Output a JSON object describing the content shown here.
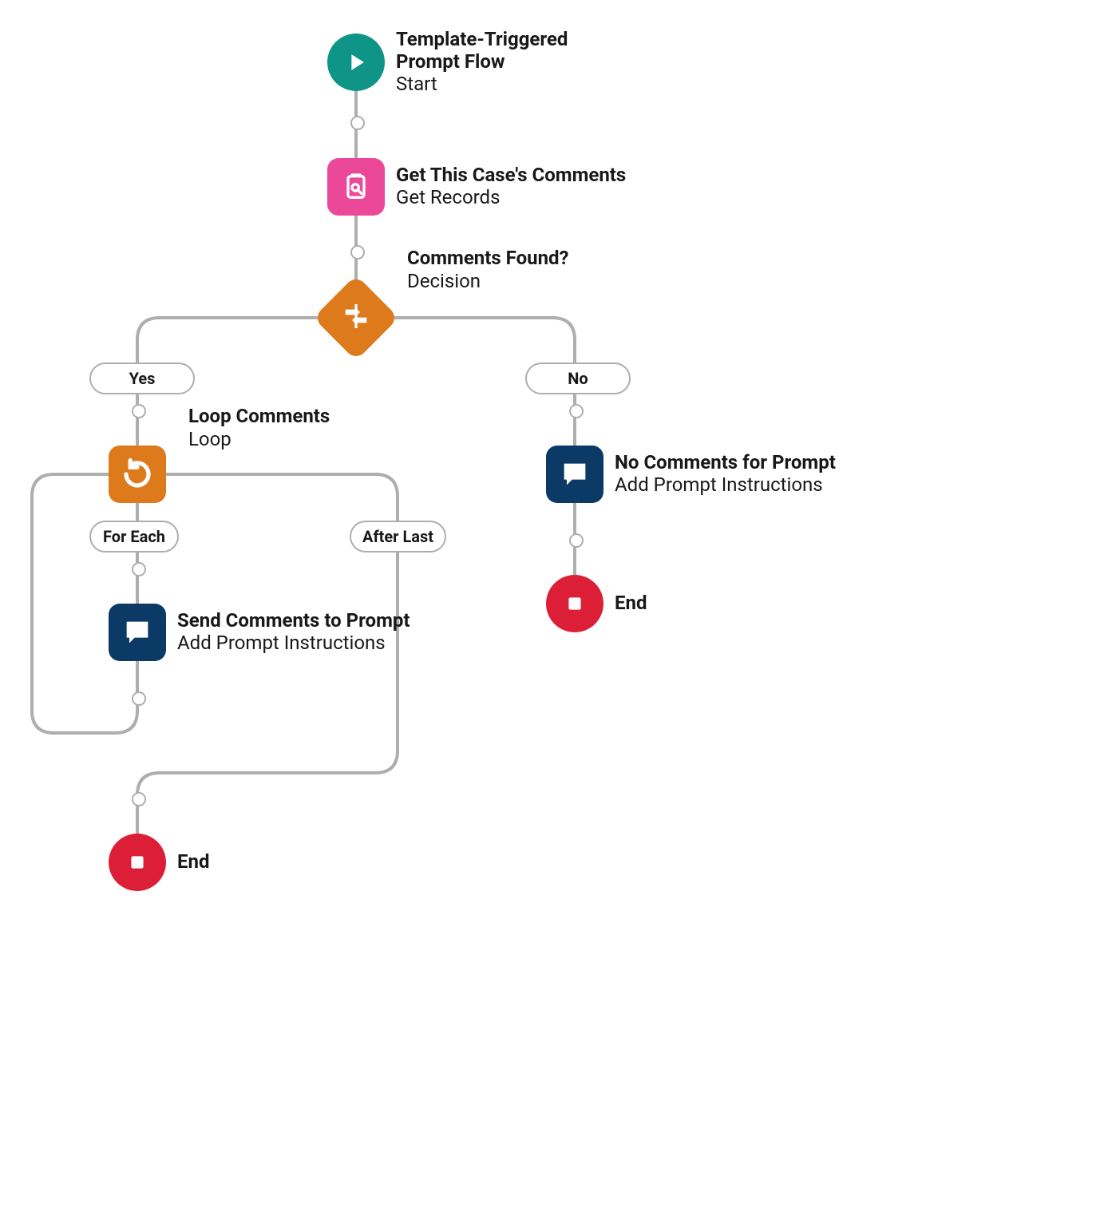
{
  "colors": {
    "teal": "#0f9488",
    "pink": "#ec4899",
    "orange": "#dd7a1b",
    "navy": "#0b3a66",
    "red": "#dc1f36",
    "line": "#aeaeae"
  },
  "nodes": {
    "start": {
      "title": "Template-Triggered Prompt Flow",
      "sub": "Start"
    },
    "getRecords": {
      "title": "Get This Case's Comments",
      "sub": "Get Records"
    },
    "decision": {
      "title": "Comments Found?",
      "sub": "Decision"
    },
    "loop": {
      "title": "Loop Comments",
      "sub": "Loop"
    },
    "sendComments": {
      "title": "Send Comments to Prompt",
      "sub": "Add Prompt Instructions"
    },
    "noComments": {
      "title": "No Comments for Prompt",
      "sub": "Add Prompt Instructions"
    },
    "end1": {
      "title": "End"
    },
    "end2": {
      "title": "End"
    }
  },
  "pills": {
    "yes": "Yes",
    "no": "No",
    "forEach": "For Each",
    "afterLast": "After Last"
  }
}
